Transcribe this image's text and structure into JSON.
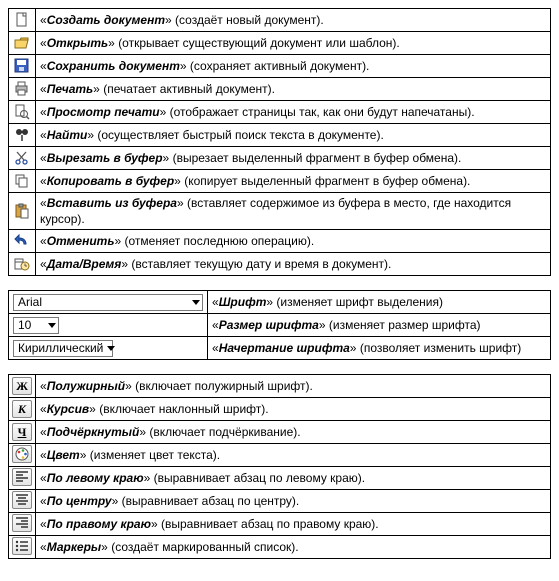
{
  "table1": [
    {
      "icon": "new-doc-icon",
      "term": "Создать документ",
      "desc": "(создаёт новый документ)."
    },
    {
      "icon": "open-icon",
      "term": "Открыть",
      "desc": "(открывает существующий документ или шаблон)."
    },
    {
      "icon": "save-icon",
      "term": "Сохранить документ",
      "desc": "(сохраняет активный документ)."
    },
    {
      "icon": "print-icon",
      "term": "Печать",
      "desc": "(печатает активный документ)."
    },
    {
      "icon": "print-preview-icon",
      "term": "Просмотр печати",
      "desc": "(отображает страницы так, как они будут напечатаны)."
    },
    {
      "icon": "find-icon",
      "term": "Найти",
      "desc": "(осуществляет быстрый поиск текста в документе)."
    },
    {
      "icon": "cut-icon",
      "term": "Вырезать в буфер",
      "desc": "(вырезает выделенный фрагмент в буфер обмена)."
    },
    {
      "icon": "copy-icon",
      "term": "Копировать в буфер",
      "desc": "(копирует выделенный фрагмент в буфер обмена)."
    },
    {
      "icon": "paste-icon",
      "term": "Вставить из буфера",
      "desc": "(вставляет содержимое из буфера в место, где находится курсор)."
    },
    {
      "icon": "undo-icon",
      "term": "Отменить",
      "desc": "(отменяет последнюю операцию)."
    },
    {
      "icon": "datetime-icon",
      "term": "Дата/Время",
      "desc": "(вставляет текущую дату и время в документ)."
    }
  ],
  "table2": [
    {
      "control": "font-dropdown",
      "value": "Arial",
      "term": "Шрифт",
      "desc": "(изменяет шрифт выделения)"
    },
    {
      "control": "size-dropdown",
      "value": "10",
      "term": "Размер шрифта",
      "desc": "(изменяет размер шрифта)"
    },
    {
      "control": "script-dropdown",
      "value": "Кириллический",
      "term": "Начертание шрифта",
      "desc": "(позволяет изменить шрифт)"
    }
  ],
  "table3": [
    {
      "icon": "bold-icon",
      "glyph": "Ж",
      "term": "Полужирный",
      "desc": "(включает полужирный шрифт)."
    },
    {
      "icon": "italic-icon",
      "glyph": "К",
      "term": "Курсив",
      "desc": "(включает наклонный шрифт)."
    },
    {
      "icon": "underline-icon",
      "glyph": "Ч",
      "term": "Подчёркнутый",
      "desc": "(включает подчёркивание)."
    },
    {
      "icon": "color-icon",
      "term": "Цвет",
      "desc": "(изменяет цвет текста)."
    },
    {
      "icon": "align-left-icon",
      "term": "По левому краю",
      "desc": "(выравнивает абзац по левому краю)."
    },
    {
      "icon": "align-center-icon",
      "term": "По центру",
      "desc": "(выравнивает абзац по центру)."
    },
    {
      "icon": "align-right-icon",
      "term": "По правому краю",
      "desc": "(выравнивает абзац по правому краю)."
    },
    {
      "icon": "bullets-icon",
      "term": "Маркеры",
      "desc": "(создаёт маркированный список)."
    }
  ],
  "quote": {
    "open": "«",
    "close": "»"
  }
}
